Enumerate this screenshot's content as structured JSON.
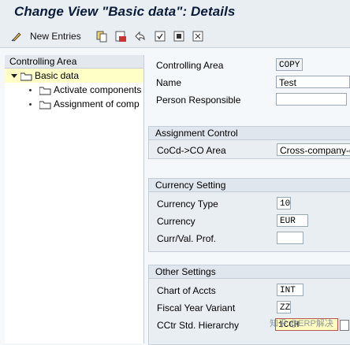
{
  "title": "Change View \"Basic data\": Details",
  "toolbar": {
    "new_entries": "New Entries"
  },
  "tree": {
    "header": "Controlling Area",
    "items": [
      {
        "label": "Basic data"
      },
      {
        "label": "Activate components"
      },
      {
        "label": "Assignment of comp"
      }
    ]
  },
  "main": {
    "controlling_area": {
      "label": "Controlling Area",
      "value": "COPY"
    },
    "name": {
      "label": "Name",
      "value": "Test"
    },
    "person_responsible": {
      "label": "Person Responsible",
      "value": ""
    },
    "assignment": {
      "title": "Assignment Control",
      "coco": {
        "label": "CoCd->CO Area",
        "value": "Cross-company-c"
      }
    },
    "currency": {
      "title": "Currency Setting",
      "type": {
        "label": "Currency Type",
        "value": "10"
      },
      "currency": {
        "label": "Currency",
        "value": "EUR"
      },
      "profile": {
        "label": "Curr/Val. Prof.",
        "value": ""
      }
    },
    "other": {
      "title": "Other Settings",
      "chart": {
        "label": "Chart of Accts",
        "value": "INT"
      },
      "fyv": {
        "label": "Fiscal Year Variant",
        "value": "ZZ"
      },
      "hier": {
        "label": "CCtr Std. Hierarchy",
        "value": "1CCH"
      }
    }
  },
  "watermark": "知乎 @ERP解决"
}
